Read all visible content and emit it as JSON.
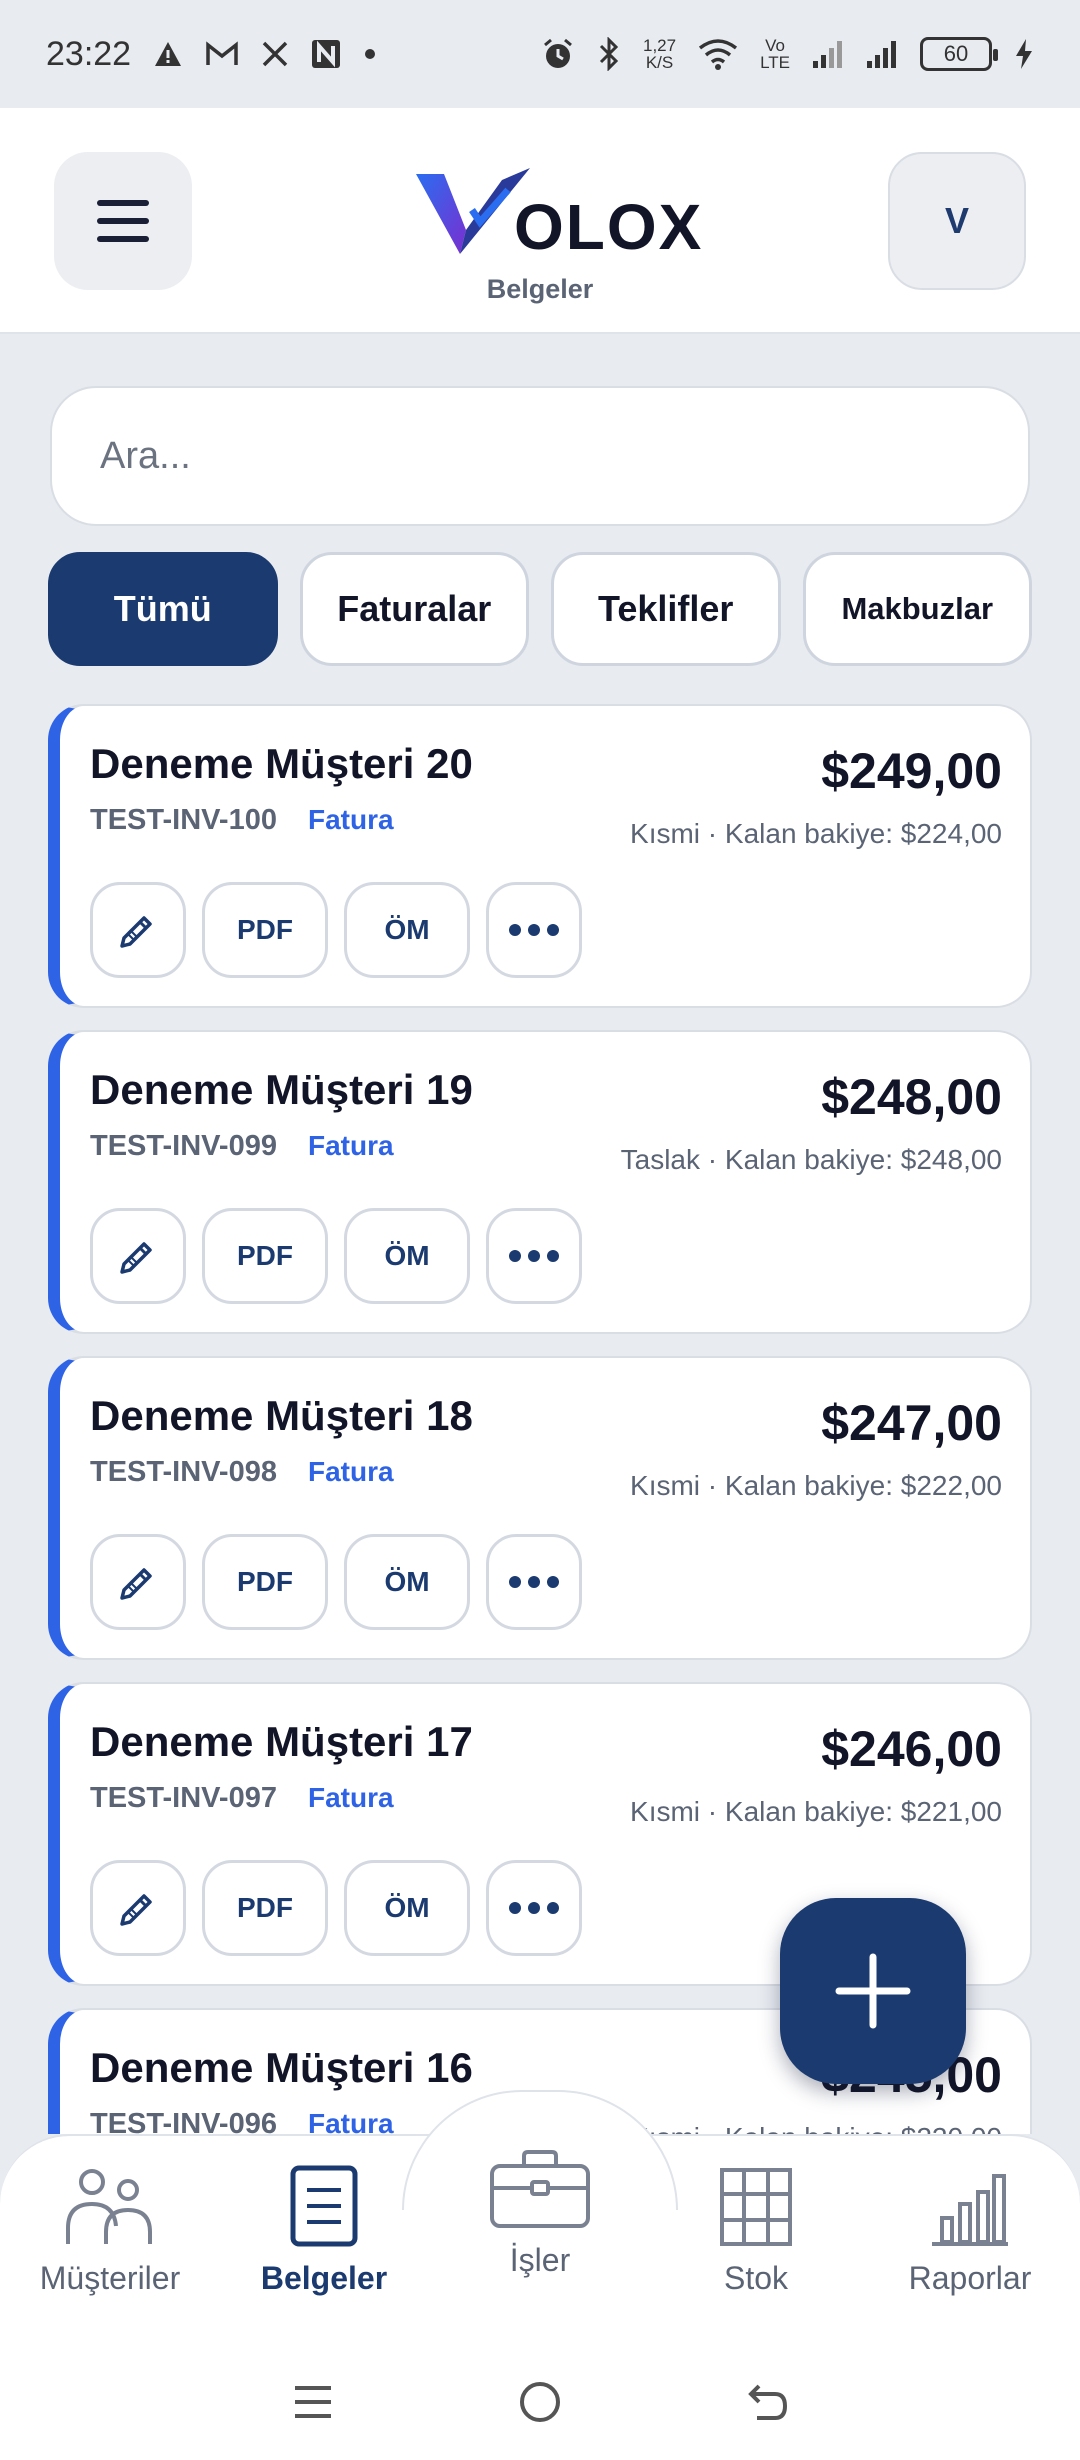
{
  "status_bar": {
    "time": "23:22",
    "left_icons": [
      "warning-icon",
      "gmail-icon",
      "x-icon",
      "n-icon",
      "dot-icon"
    ],
    "net_speed": "1,27",
    "net_unit": "K/S",
    "volte": "Vo",
    "volte2": "LTE",
    "battery": "60"
  },
  "header": {
    "menu_icon": "menu-icon",
    "logo_text": "OLOX",
    "subtitle": "Belgeler",
    "avatar": "V"
  },
  "search": {
    "placeholder": "Ara..."
  },
  "filters": [
    {
      "label": "Tümü",
      "active": true
    },
    {
      "label": "Faturalar",
      "active": false
    },
    {
      "label": "Teklifler",
      "active": false
    },
    {
      "label": "Makbuzlar",
      "active": false
    }
  ],
  "documents": [
    {
      "customer": "Deneme Müşteri 20",
      "number": "TEST-INV-100",
      "type": "Fatura",
      "amount": "$249,00",
      "status": "Kısmi · Kalan bakiye: $224,00"
    },
    {
      "customer": "Deneme Müşteri 19",
      "number": "TEST-INV-099",
      "type": "Fatura",
      "amount": "$248,00",
      "status": "Taslak · Kalan bakiye: $248,00"
    },
    {
      "customer": "Deneme Müşteri 18",
      "number": "TEST-INV-098",
      "type": "Fatura",
      "amount": "$247,00",
      "status": "Kısmi · Kalan bakiye: $222,00"
    },
    {
      "customer": "Deneme Müşteri 17",
      "number": "TEST-INV-097",
      "type": "Fatura",
      "amount": "$246,00",
      "status": "Kısmi · Kalan bakiye: $221,00"
    },
    {
      "customer": "Deneme Müşteri 16",
      "number": "TEST-INV-096",
      "type": "Fatura",
      "amount": "$245,00",
      "status": "Kısmi · Kalan bakiye: $220,00"
    }
  ],
  "actions": {
    "edit_icon": "pencil-icon",
    "pdf": "PDF",
    "om": "ÖM",
    "more_icon": "more-icon"
  },
  "fab": {
    "icon": "plus-icon"
  },
  "bottom_nav": [
    {
      "label": "Müşteriler",
      "icon": "customers-icon",
      "active": false
    },
    {
      "label": "Belgeler",
      "icon": "documents-icon",
      "active": true
    },
    {
      "label": "İşler",
      "icon": "briefcase-icon",
      "active": false
    },
    {
      "label": "Stok",
      "icon": "grid-icon",
      "active": false
    },
    {
      "label": "Raporlar",
      "icon": "chart-icon",
      "active": false
    }
  ],
  "colors": {
    "primary": "#1b3a6f",
    "accent": "#2f63e6",
    "background": "#e8ebf0"
  }
}
